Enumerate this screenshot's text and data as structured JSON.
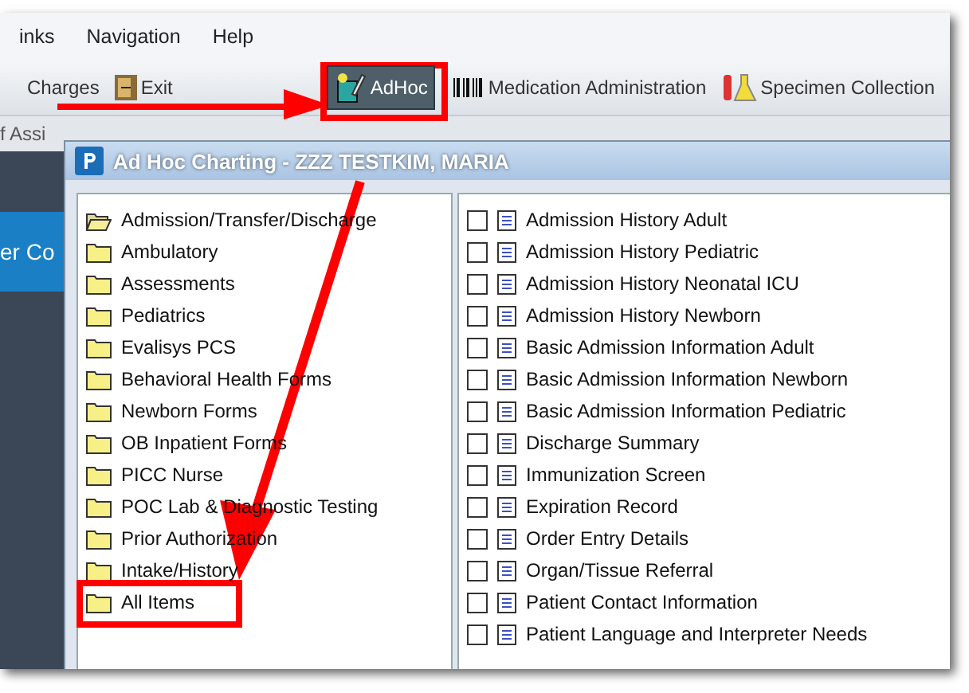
{
  "menu": [
    "inks",
    "Navigation",
    "Help"
  ],
  "toolbar": [
    {
      "label": "Charges",
      "selected": false
    },
    {
      "label": "Exit",
      "selected": false
    },
    {
      "label": "AdHoc",
      "selected": true
    },
    {
      "label": "Medication Administration",
      "selected": false
    },
    {
      "label": "Specimen Collection",
      "selected": false
    }
  ],
  "toolbar2": [
    "f Assi"
  ],
  "background_text": "er Co",
  "dialog": {
    "title": "Ad Hoc Charting - ZZZ TESTKIM, MARIA",
    "folders": [
      {
        "label": "Admission/Transfer/Discharge",
        "open": true
      },
      {
        "label": "Ambulatory",
        "open": false
      },
      {
        "label": "Assessments",
        "open": false
      },
      {
        "label": "Pediatrics",
        "open": false
      },
      {
        "label": "Evalisys PCS",
        "open": false
      },
      {
        "label": "Behavioral Health Forms",
        "open": false
      },
      {
        "label": "Newborn Forms",
        "open": false
      },
      {
        "label": "OB Inpatient Forms",
        "open": false
      },
      {
        "label": "PICC Nurse",
        "open": false
      },
      {
        "label": "POC Lab & Diagnostic Testing",
        "open": false
      },
      {
        "label": "Prior Authorization",
        "open": false
      },
      {
        "label": "Intake/History",
        "open": false
      },
      {
        "label": "All Items",
        "open": false
      }
    ],
    "forms": [
      {
        "label": "Admission History Adult",
        "checked": false
      },
      {
        "label": "Admission History Pediatric",
        "checked": false
      },
      {
        "label": "Admission History Neonatal ICU",
        "checked": false
      },
      {
        "label": "Admission History Newborn",
        "checked": false
      },
      {
        "label": "Basic Admission Information Adult",
        "checked": false
      },
      {
        "label": "Basic Admission Information Newborn",
        "checked": false
      },
      {
        "label": "Basic Admission Information Pediatric",
        "checked": false
      },
      {
        "label": "Discharge Summary",
        "checked": false
      },
      {
        "label": "Immunization Screen",
        "checked": false
      },
      {
        "label": "Expiration Record",
        "checked": false
      },
      {
        "label": "Order Entry Details",
        "checked": false
      },
      {
        "label": "Organ/Tissue Referral",
        "checked": false
      },
      {
        "label": "Patient Contact Information",
        "checked": false
      },
      {
        "label": "Patient Language and Interpreter Needs",
        "checked": false
      }
    ]
  }
}
